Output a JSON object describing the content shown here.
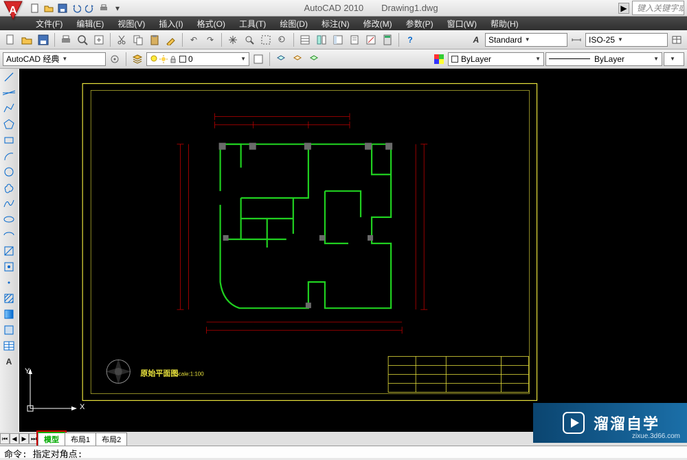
{
  "title": {
    "app": "AutoCAD 2010",
    "file": "Drawing1.dwg"
  },
  "search_placeholder": "键入关键字或",
  "menus": [
    "文件(F)",
    "编辑(E)",
    "视图(V)",
    "插入(I)",
    "格式(O)",
    "工具(T)",
    "绘图(D)",
    "标注(N)",
    "修改(M)",
    "参数(P)",
    "窗口(W)",
    "帮助(H)"
  ],
  "workspace": "AutoCAD 经典",
  "layer_current": "0",
  "style_text": "Standard",
  "style_dim": "ISO-25",
  "layer_color": "ByLayer",
  "linetype": "ByLayer",
  "drawing": {
    "title": "原始平面图",
    "scale": "Scale:1:100"
  },
  "tabs": {
    "model": "模型",
    "layout1": "布局1",
    "layout2": "布局2"
  },
  "command": "命令: 指定对角点:",
  "watermark": {
    "brand": "溜溜自学",
    "url": "zixue.3d66.com"
  },
  "ucs": {
    "x": "X",
    "y": "Y"
  }
}
